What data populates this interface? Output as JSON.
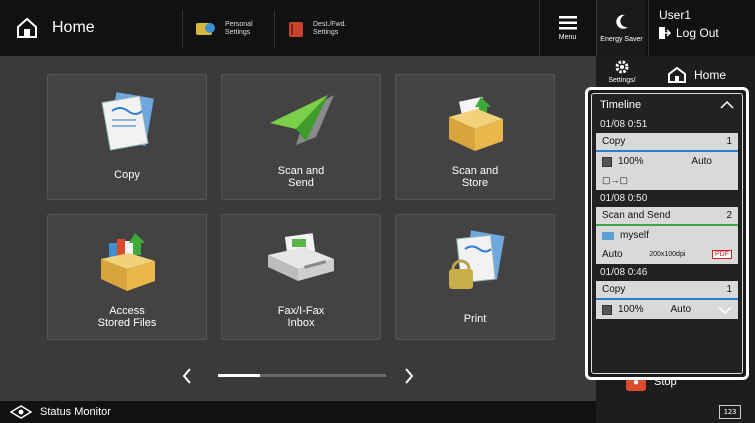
{
  "header": {
    "title": "Home",
    "personal_settings": "Personal Settings",
    "dest_fwd_settings": "Dest./Fwd. Settings",
    "menu": "Menu",
    "energy_saver": "Energy Saver",
    "user": "User1",
    "log_out": "Log Out"
  },
  "right_panel": {
    "settings": "Settings/",
    "home": "Home",
    "stop": "Stop",
    "keyboard": "123"
  },
  "tiles": [
    {
      "label": "Copy",
      "icon": "copy-icon"
    },
    {
      "label": "Scan and Send",
      "icon": "paper-plane-icon"
    },
    {
      "label": "Scan and Store",
      "icon": "storage-box-icon"
    },
    {
      "label": "Access Stored Files",
      "icon": "stored-files-icon"
    },
    {
      "label": "Fax/I-Fax Inbox",
      "icon": "fax-icon"
    },
    {
      "label": "Print",
      "icon": "print-lock-icon"
    }
  ],
  "timeline": {
    "title": "Timeline",
    "entries": [
      {
        "time": "01/08 0:51",
        "job": "Copy",
        "count": "1",
        "zoom": "100%",
        "mode": "Auto"
      },
      {
        "time": "01/08 0:50",
        "job": "Scan and Send",
        "count": "2",
        "dest": "myself",
        "color": "Auto",
        "res": "200x100dpi",
        "format": "PDF"
      },
      {
        "time": "01/08 0:46",
        "job": "Copy",
        "count": "1",
        "zoom": "100%",
        "mode": "Auto"
      }
    ]
  },
  "status_bar": {
    "label": "Status Monitor"
  },
  "colors": {
    "top_bar": "#111111",
    "background": "#3a3a3a",
    "stop_accent": "#d94b2c",
    "copy_line": "#2a7fd4",
    "send_line": "#3aa845"
  }
}
